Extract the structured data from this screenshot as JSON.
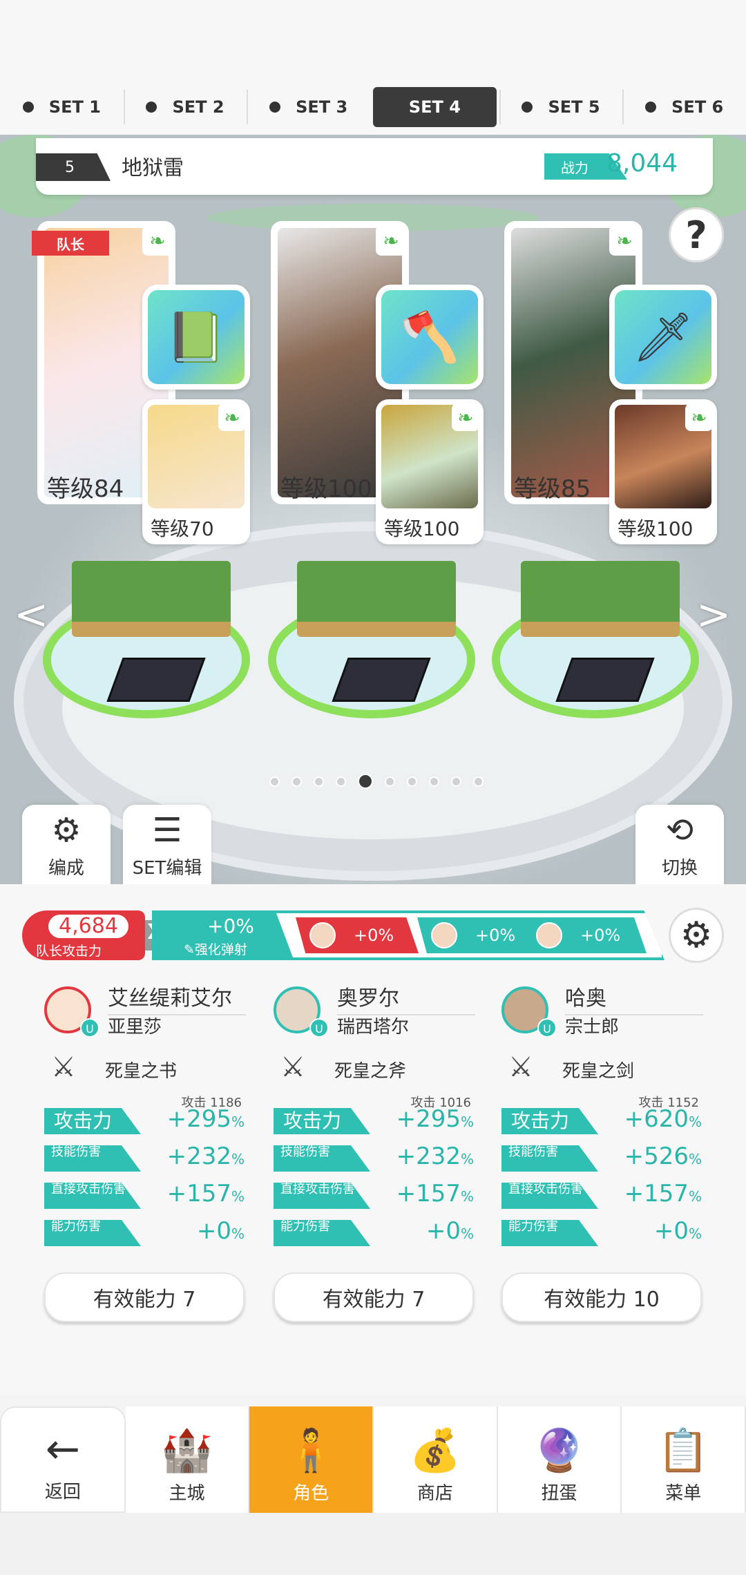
{
  "tabs": [
    "SET 1",
    "SET 2",
    "SET 3",
    "SET 4",
    "SET 5",
    "SET 6"
  ],
  "active_tab": "SET 4",
  "team": {
    "number": "5",
    "name": "地狱雷",
    "cp_label": "战力",
    "cp_value": "8,044"
  },
  "heroes": [
    {
      "level": "等级84",
      "sub_level": "等级70",
      "captain": "队长"
    },
    {
      "level": "等级100",
      "sub_level": "等级100"
    },
    {
      "level": "等级85",
      "sub_level": "等级100"
    }
  ],
  "pager": {
    "count": 10,
    "active": 5
  },
  "buttons": {
    "formation": "编成",
    "set_edit": "SET编辑",
    "switch": "切换"
  },
  "bonus": {
    "leader_atk_value": "4,684",
    "leader_atk_label": "队长攻击力",
    "x": "X",
    "bounce_value": "+0%",
    "bounce_label": "强化弹射",
    "mini": [
      "+0%",
      "+0%",
      "+0%"
    ]
  },
  "columns": [
    {
      "hero": "艾丝缇莉艾尔",
      "chain": "亚里莎",
      "weapon": "死皇之书",
      "atk_label": "攻击力",
      "atk_base": "攻击 1186",
      "atk_pct": "+295",
      "skill_label": "技能伤害",
      "skill_pct": "+232",
      "direct_label": "直接攻击伤害",
      "direct_pct": "+157",
      "ability_label": "能力伤害",
      "ability_pct": "+0",
      "effective": "有效能力 7"
    },
    {
      "hero": "奥罗尔",
      "chain": "瑞西塔尔",
      "weapon": "死皇之斧",
      "atk_label": "攻击力",
      "atk_base": "攻击 1016",
      "atk_pct": "+295",
      "skill_label": "技能伤害",
      "skill_pct": "+232",
      "direct_label": "直接攻击伤害",
      "direct_pct": "+157",
      "ability_label": "能力伤害",
      "ability_pct": "+0",
      "effective": "有效能力 7"
    },
    {
      "hero": "哈奥",
      "chain": "宗士郎",
      "weapon": "死皇之剑",
      "atk_label": "攻击力",
      "atk_base": "攻击 1152",
      "atk_pct": "+620",
      "skill_label": "技能伤害",
      "skill_pct": "+526",
      "direct_label": "直接攻击伤害",
      "direct_pct": "+157",
      "ability_label": "能力伤害",
      "ability_pct": "+0",
      "effective": "有效能力 10"
    }
  ],
  "percent": "%",
  "nav": [
    {
      "label": "返回",
      "icon": "back-arrow-icon"
    },
    {
      "label": "主城",
      "icon": "castle-icon"
    },
    {
      "label": "角色",
      "icon": "character-icon"
    },
    {
      "label": "商店",
      "icon": "shop-icon"
    },
    {
      "label": "扭蛋",
      "icon": "gacha-icon"
    },
    {
      "label": "菜单",
      "icon": "menu-icon"
    }
  ],
  "colors": {
    "accent": "#2fbfb3",
    "captain": "#e2373f",
    "nav_active": "#f7a21b"
  }
}
